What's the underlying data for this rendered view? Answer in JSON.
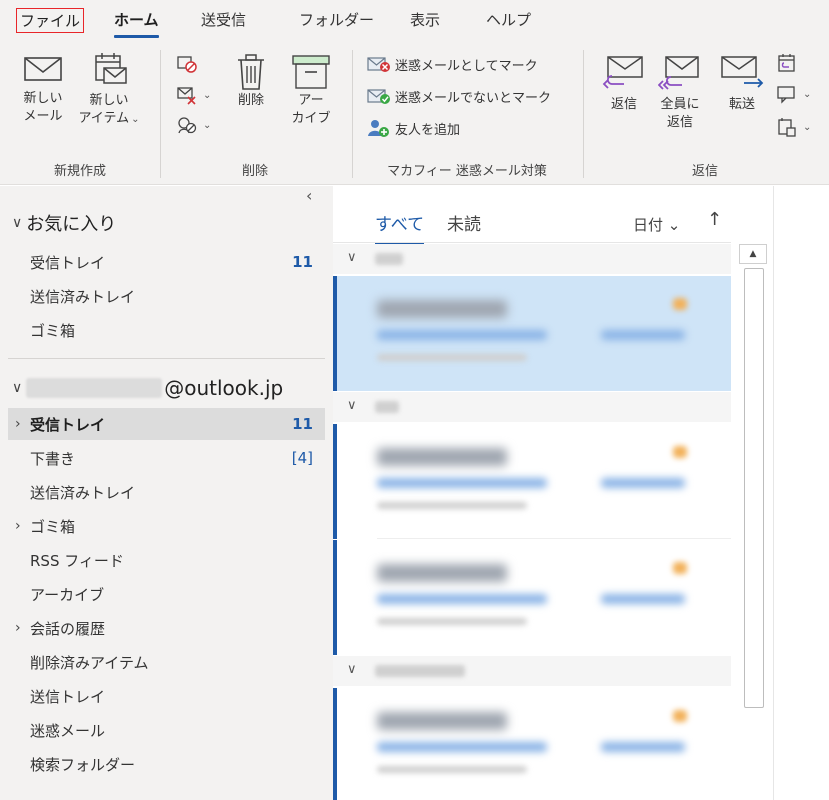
{
  "tabs": [
    {
      "label": "ファイル"
    },
    {
      "label": "ホーム"
    },
    {
      "label": "送受信"
    },
    {
      "label": "フォルダー"
    },
    {
      "label": "表示"
    },
    {
      "label": "ヘルプ"
    }
  ],
  "ribbon": {
    "new_group": {
      "label": "新規作成",
      "new_mail": {
        "line1": "新しい",
        "line2": "メール"
      },
      "new_item": {
        "line1": "新しい",
        "line2": "アイテム"
      }
    },
    "delete_group": {
      "label": "削除",
      "delete": "削除",
      "archive": {
        "line1": "アー",
        "line2": "カイブ"
      }
    },
    "mcafee_group": {
      "label": "マカフィー 迷惑メール対策",
      "mark_spam": "迷惑メールとしてマーク",
      "mark_not_spam": "迷惑メールでないとマーク",
      "add_friend": "友人を追加"
    },
    "reply_group": {
      "label": "返信",
      "reply": "返信",
      "reply_all": {
        "line1": "全員に",
        "line2": "返信"
      },
      "forward": "転送"
    }
  },
  "nav": {
    "favorites": {
      "header": "お気に入り",
      "items": [
        {
          "name": "受信トレイ",
          "count": "11"
        },
        {
          "name": "送信済みトレイ",
          "count": ""
        },
        {
          "name": "ゴミ箱",
          "count": ""
        }
      ]
    },
    "account": {
      "domain": "@outlook.jp",
      "items": [
        {
          "name": "受信トレイ",
          "count": "11"
        },
        {
          "name": "下書き",
          "count": "[4]"
        },
        {
          "name": "送信済みトレイ",
          "count": ""
        },
        {
          "name": "ゴミ箱",
          "count": ""
        },
        {
          "name": "RSS フィード",
          "count": ""
        },
        {
          "name": "アーカイブ",
          "count": ""
        },
        {
          "name": "会話の履歴",
          "count": ""
        },
        {
          "name": "削除済みアイテム",
          "count": ""
        },
        {
          "name": "送信トレイ",
          "count": ""
        },
        {
          "name": "迷惑メール",
          "count": ""
        },
        {
          "name": "検索フォルダー",
          "count": ""
        }
      ]
    }
  },
  "list": {
    "filter_all": "すべて",
    "filter_unread": "未読",
    "sort_label": "日付",
    "sort_arrow": "↑"
  },
  "colors": {
    "accent": "#1e5aa8",
    "selected_message_bg": "#cfe4f7",
    "file_tab_outline": "#e8262a"
  }
}
